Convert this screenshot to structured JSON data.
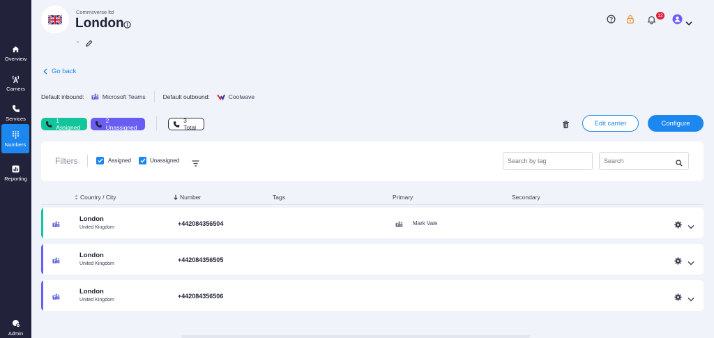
{
  "sidebar": {
    "items": [
      {
        "label": "Overview",
        "icon": "home-icon"
      },
      {
        "label": "Carriers",
        "icon": "antenna-icon"
      },
      {
        "label": "Services",
        "icon": "phone-icon"
      },
      {
        "label": "Numbers",
        "icon": "dialpad-icon",
        "active": true
      },
      {
        "label": "Reporting",
        "icon": "chart-icon"
      }
    ],
    "admin_label": "Admin"
  },
  "header": {
    "company": "Commsverse ltd",
    "title": "London",
    "subtitle": "-",
    "notifications_count": "12"
  },
  "nav": {
    "go_back": "Go back"
  },
  "defaults": {
    "inbound_label": "Default inbound:",
    "inbound_value": "Microsoft Teams",
    "outbound_label": "Default outbound:",
    "outbound_value": "Coolwave"
  },
  "pills": {
    "assigned": "1 Assigned",
    "unassigned": "2 Unassigned",
    "total": "3 Total"
  },
  "actions": {
    "edit_carrier": "Edit carrier",
    "configure": "Configure"
  },
  "filters": {
    "title": "Filters",
    "assigned_label": "Assigned",
    "unassigned_label": "Unassigned",
    "search_tag_placeholder": "Search by tag",
    "search_placeholder": "Search"
  },
  "table": {
    "columns": [
      "Country / City",
      "Number",
      "Tags",
      "Primary",
      "Secondary"
    ],
    "rows": [
      {
        "city": "London",
        "country": "United Kingdom",
        "number": "+442084356504",
        "primary": "Mark Vale",
        "status_color": "#13c59a"
      },
      {
        "city": "London",
        "country": "United Kingdom",
        "number": "+442084356505",
        "primary": "",
        "status_color": "#6a5df3"
      },
      {
        "city": "London",
        "country": "United Kingdom",
        "number": "+442084356506",
        "primary": "",
        "status_color": "#6a5df3"
      }
    ]
  },
  "colors": {
    "accent": "#1d87f0",
    "sidebar": "#22223b",
    "assigned": "#13c59a",
    "unassigned": "#6a5df3"
  }
}
